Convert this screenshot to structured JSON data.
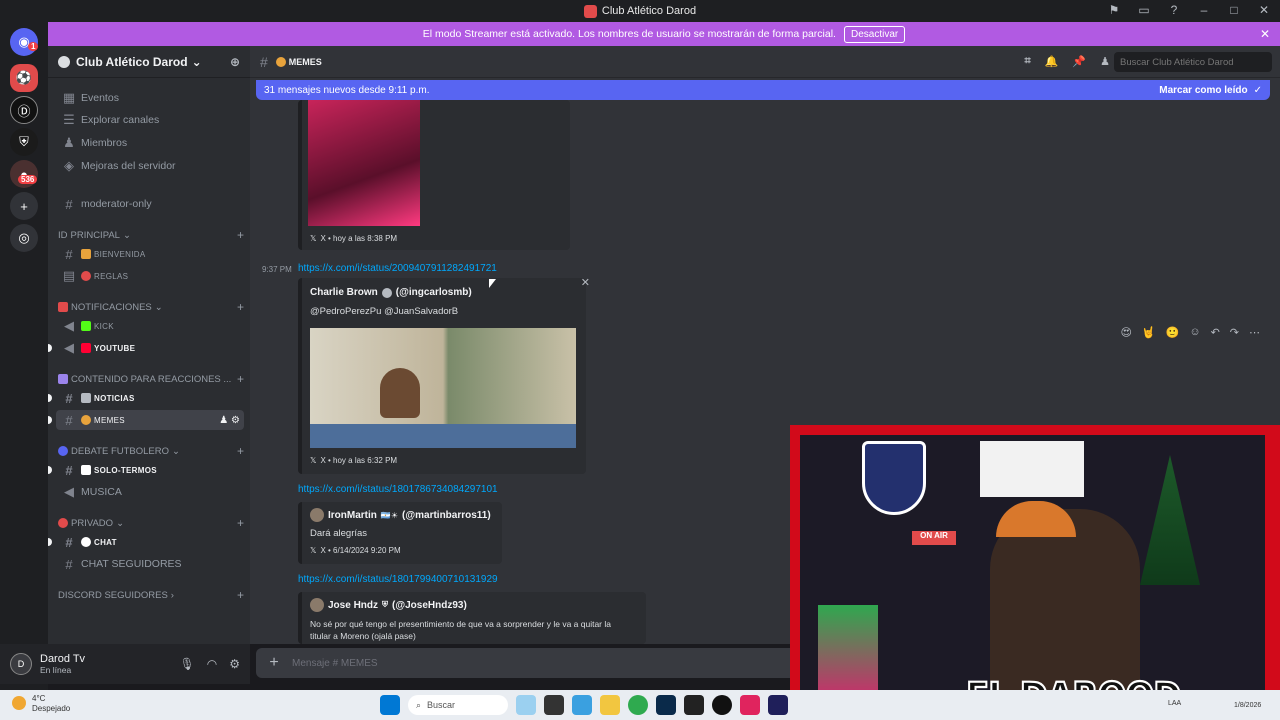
{
  "window": {
    "title": "Club Atlético Darod"
  },
  "streamer_banner": {
    "text": "El modo Streamer está activado. Los nombres de usuario se mostrarán de forma parcial.",
    "button": "Desactivar"
  },
  "server_rail": {
    "badge_top": "1",
    "badge_bottom": "536"
  },
  "guild": {
    "name": "Club Atlético Darod"
  },
  "sidebar": {
    "top_items": [
      "Eventos",
      "Explorar canales",
      "Miembros",
      "Mejoras del servidor"
    ],
    "moderator": "moderator-only",
    "cat_principal": "PRINCIPAL",
    "bienvenida": "BIENVENIDA",
    "reglas": "REGLAS",
    "cat_notificaciones": "NOTIFICACIONES",
    "kick": "KICK",
    "youtube": "YOUTUBE",
    "cat_contenido": "CONTENIDO PARA REACCIONES ...",
    "noticias": "NOTICIAS",
    "memes": "MEMES",
    "cat_debate": "DEBATE FUTBOLERO",
    "solo_termos": "SOLO-TERMOS",
    "musica": "MUSICA",
    "cat_privado": "PRIVADO",
    "chat": "CHAT",
    "chat_seguidores": "CHAT SEGUIDORES",
    "cat_discord_seguidores": "DISCORD SEGUIDORES"
  },
  "user_panel": {
    "name": "Darod Tv",
    "status": "En línea"
  },
  "channel_header": {
    "name": "MEMES",
    "search_placeholder": "Buscar Club Atlético Darod"
  },
  "new_messages": {
    "text": "31 mensajes nuevos desde 9:11 p.m.",
    "mark": "Marcar como leído"
  },
  "messages": {
    "embed1_footer": "X • hoy a las 8:38 PM",
    "msg_time": "9:37 PM",
    "link1": "https://x.com/i/status/2009407911282491721",
    "embed2_author": "Charlie Brown",
    "embed2_handle": "(@ingcarlosmb)",
    "embed2_text": "@PedroPerezPu @JuanSalvadorB",
    "embed2_footer": "X • hoy a las 6:32 PM",
    "link2": "https://x.com/i/status/1801786734084297101",
    "embed3_author": "IronMartin",
    "embed3_handle": "(@martinbarros11)",
    "embed3_text": "Dará alegrías",
    "embed3_footer": "X • 6/14/2024 9:20 PM",
    "link3": "https://x.com/i/status/1801799400710131929",
    "embed4_author": "Jose Hndz",
    "embed4_handle": "(@JoseHndz93)",
    "embed4_text": "No sé por qué tengo el presentimiento de que va a sorprender y le va a quitar la titular a Moreno (ojalá pase)"
  },
  "composer": {
    "placeholder": "Mensaje #  MEMES"
  },
  "taskbar": {
    "temp": "4°C",
    "weather": "Despejado",
    "search": "Buscar",
    "lang": "LAA",
    "date": "1/8/2026"
  },
  "webcam": {
    "overlay": "EL DAROOD"
  },
  "colors": {
    "accent": "#5865f2",
    "streamer": "#b15ae2",
    "link": "#00a8fc",
    "bg": "#313338"
  }
}
